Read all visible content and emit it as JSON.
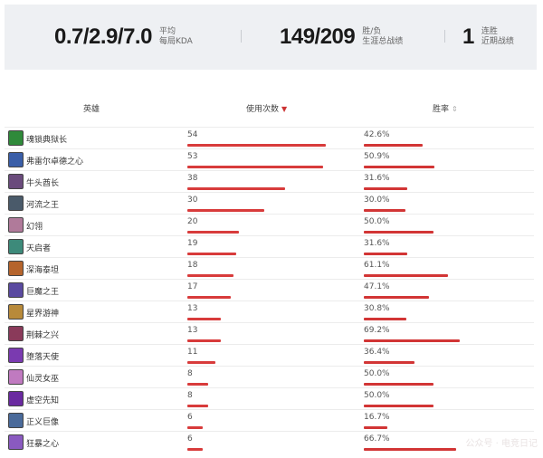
{
  "summary": {
    "kda": {
      "value": "0.7/2.9/7.0",
      "label_top": "平均",
      "label_bottom": "每局KDA"
    },
    "record": {
      "value": "149/209",
      "label_top": "胜/负",
      "label_bottom": "生涯总战绩"
    },
    "streak": {
      "value": "1",
      "label_top": "连胜",
      "label_bottom": "近期战绩"
    }
  },
  "table": {
    "headers": {
      "hero": "英雄",
      "uses": "使用次数",
      "winrate": "胜率"
    },
    "sort_icons": {
      "uses": "sort-desc-icon",
      "winrate": "sort-toggle-icon"
    },
    "max_uses": 54,
    "rows": [
      {
        "name": "魂锁典狱长",
        "uses": 54,
        "winrate": "42.6%",
        "wr": 42.6,
        "color": "#2f8a3a"
      },
      {
        "name": "弗雷尔卓德之心",
        "uses": 53,
        "winrate": "50.9%",
        "wr": 50.9,
        "color": "#3a5ea8"
      },
      {
        "name": "牛头酋长",
        "uses": 38,
        "winrate": "31.6%",
        "wr": 31.6,
        "color": "#6a4b7c"
      },
      {
        "name": "河流之王",
        "uses": 30,
        "winrate": "30.0%",
        "wr": 30.0,
        "color": "#4a5a6a"
      },
      {
        "name": "幻翎",
        "uses": 20,
        "winrate": "50.0%",
        "wr": 50.0,
        "color": "#b07a9a"
      },
      {
        "name": "天启者",
        "uses": 19,
        "winrate": "31.6%",
        "wr": 31.6,
        "color": "#3d8a7a"
      },
      {
        "name": "深海泰坦",
        "uses": 18,
        "winrate": "61.1%",
        "wr": 61.1,
        "color": "#b5642c"
      },
      {
        "name": "巨魔之王",
        "uses": 17,
        "winrate": "47.1%",
        "wr": 47.1,
        "color": "#5a4aa0"
      },
      {
        "name": "星界游神",
        "uses": 13,
        "winrate": "30.8%",
        "wr": 30.8,
        "color": "#b88a3a"
      },
      {
        "name": "荆棘之兴",
        "uses": 13,
        "winrate": "69.2%",
        "wr": 69.2,
        "color": "#8a3a5a"
      },
      {
        "name": "堕落天使",
        "uses": 11,
        "winrate": "36.4%",
        "wr": 36.4,
        "color": "#7a3ab0"
      },
      {
        "name": "仙灵女巫",
        "uses": 8,
        "winrate": "50.0%",
        "wr": 50.0,
        "color": "#c07ac0"
      },
      {
        "name": "虚空先知",
        "uses": 8,
        "winrate": "50.0%",
        "wr": 50.0,
        "color": "#6a2aa0"
      },
      {
        "name": "正义巨像",
        "uses": 6,
        "winrate": "16.7%",
        "wr": 16.7,
        "color": "#4a6a9a"
      },
      {
        "name": "狂暴之心",
        "uses": 6,
        "winrate": "66.7%",
        "wr": 66.7,
        "color": "#8a5ac0"
      }
    ]
  },
  "colors": {
    "bar": "#d83b3b",
    "stats_bg": "#eef0f3"
  },
  "watermark": "公众号 · 电竞日记"
}
